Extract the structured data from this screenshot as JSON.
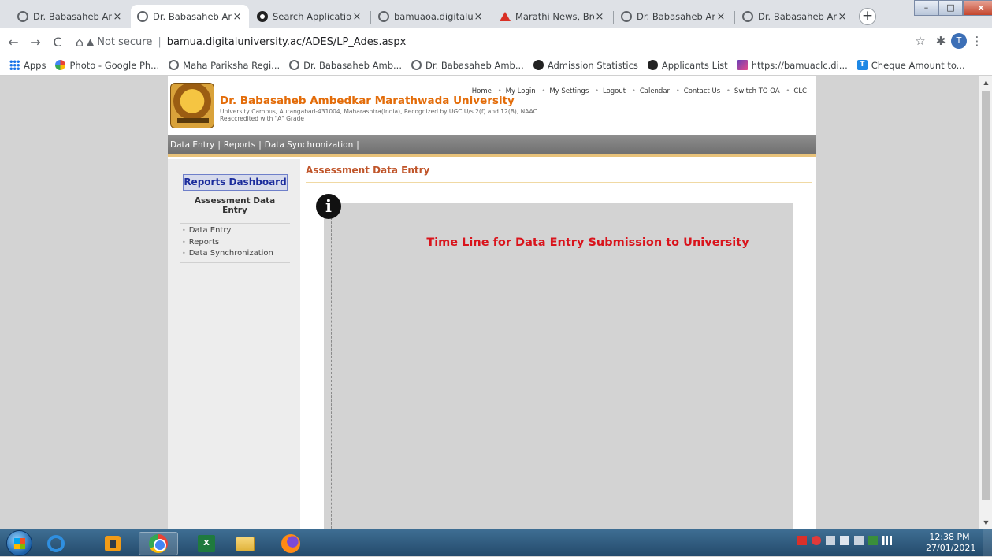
{
  "browser": {
    "tabs": [
      {
        "title": "Dr. Babasaheb Amb",
        "icon": "globe-icon",
        "active": false
      },
      {
        "title": "Dr. Babasaheb Amb",
        "icon": "globe-icon",
        "active": true
      },
      {
        "title": "Search Application",
        "icon": "generic-site-icon",
        "active": false
      },
      {
        "title": "bamuaoa.digitalun",
        "icon": "globe-icon",
        "active": false
      },
      {
        "title": "Marathi News, Brea",
        "icon": "red-triangle-icon",
        "active": false
      },
      {
        "title": "Dr. Babasaheb Amb",
        "icon": "globe-icon",
        "active": false
      },
      {
        "title": "Dr. Babasaheb Amb",
        "icon": "globe-icon",
        "active": false
      }
    ],
    "tab_close": "×",
    "new_tab": "+",
    "nav_back": "←",
    "nav_forward": "→",
    "nav_reload": "C",
    "nav_home": "⌂",
    "security_warning": "▲",
    "security_label": "Not secure",
    "url": "bamua.digitaluniversity.ac/ADES/LP_Ades.aspx",
    "star": "☆",
    "extensions": "✱",
    "profile_initial": "T",
    "menu": "⋮",
    "win_min": "–",
    "win_max": "□",
    "win_close": "x"
  },
  "bookmarks": [
    {
      "label": "Apps",
      "icon": "apps-grid-icon"
    },
    {
      "label": "Photo - Google Ph...",
      "icon": "photos-pinwheel-icon"
    },
    {
      "label": "Maha Pariksha Regi...",
      "icon": "globe-icon"
    },
    {
      "label": "Dr. Babasaheb Amb...",
      "icon": "globe-icon"
    },
    {
      "label": "Dr. Babasaheb Amb...",
      "icon": "globe-icon"
    },
    {
      "label": "Admission Statistics",
      "icon": "generic-site-icon"
    },
    {
      "label": "Applicants List",
      "icon": "generic-site-icon"
    },
    {
      "label": "https://bamuaclc.di...",
      "icon": "site-square-icon"
    },
    {
      "label": "Cheque Amount to...",
      "icon": "t-square-icon"
    }
  ],
  "site": {
    "university_name": "Dr. Babasaheb Ambedkar Marathwada University",
    "university_address": "University Campus, Aurangabad-431004, Maharashtra(India), Recognized by UGC U/s 2(f) and 12(B), NAAC",
    "university_grade": "Reaccredited with \"A\" Grade",
    "top_links": [
      "Home",
      "My Login",
      "My Settings",
      "Logout",
      "Calendar",
      "Contact Us",
      "Switch TO OA",
      "CLC"
    ],
    "menu_items": [
      "Data Entry",
      "Reports",
      "Data Synchronization"
    ],
    "menu_separator": "|"
  },
  "sidebar": {
    "dashboard_button": "Reports Dashboard",
    "section_title": "Assessment Data Entry",
    "links": [
      "Data Entry",
      "Reports",
      "Data Synchronization"
    ]
  },
  "content": {
    "title": "Assessment Data Entry",
    "info_glyph": "i",
    "timeline_link": "Time Line for Data Entry Submission to University"
  },
  "taskbar": {
    "apps": [
      {
        "name": "internet-explorer-icon"
      },
      {
        "name": "media-player-icon"
      },
      {
        "name": "chrome-icon"
      },
      {
        "name": "excel-icon"
      },
      {
        "name": "file-explorer-icon"
      },
      {
        "name": "firefox-icon"
      }
    ],
    "time": "12:38 PM",
    "date": "27/01/2021"
  },
  "colors": {
    "university_name": "#e36c09",
    "content_title": "#c0552a",
    "timeline_link": "#d9141c",
    "dashboard_text": "#1b2c9c"
  }
}
